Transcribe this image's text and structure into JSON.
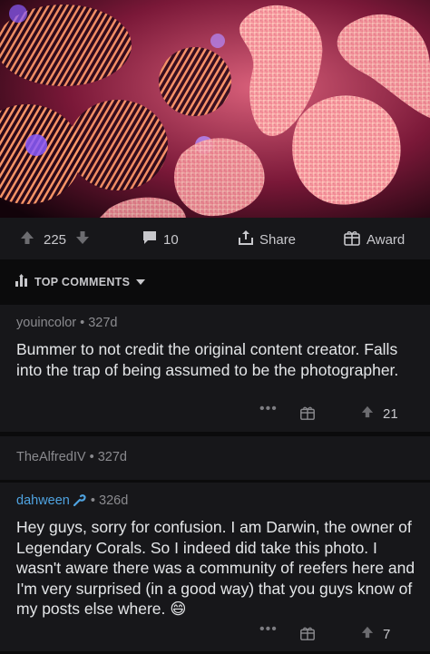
{
  "post": {
    "image_icon": "coral-photo",
    "upvotes": "225",
    "comments": "10",
    "share_label": "Share",
    "award_label": "Award"
  },
  "sort": {
    "label": "TOP COMMENTS"
  },
  "comments": [
    {
      "user": "youincolor",
      "age": "327d",
      "body": "Bummer to not credit the original content creator. Falls into the trap of being assumed to be the photographer.",
      "score": "21"
    },
    {
      "user": "TheAlfredIV",
      "age": "327d"
    },
    {
      "user": "dahween",
      "user_badge_icon": "wrench-icon",
      "age": "326d",
      "body": "Hey guys, sorry for confusion. I am Darwin, the owner of Legendary Corals. So I indeed did take this photo. I wasn't aware there was a community of reefers here and I'm very surprised (in a good way) that you guys know of my posts else where. 😄",
      "score": "7"
    }
  ],
  "colors": {
    "background": "#0b0b0c",
    "card": "#17171a",
    "username_op": "#4fa3e0",
    "muted": "#8a8a8e"
  }
}
